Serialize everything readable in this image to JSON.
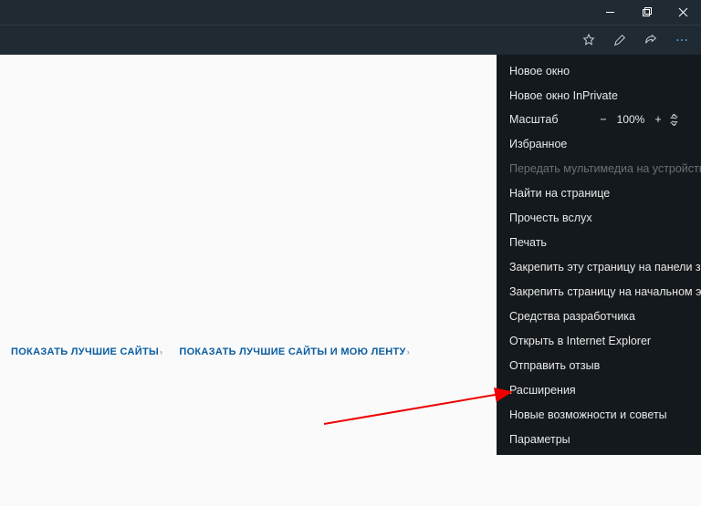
{
  "titlebar": {
    "minimize": "minimize",
    "maximize": "maximize",
    "close": "close"
  },
  "toolbar": {
    "favorite": "add-favorite",
    "notes": "add-notes",
    "share": "share",
    "more": "more"
  },
  "content": {
    "link1": "ПОКАЗАТЬ ЛУЧШИЕ САЙТЫ",
    "link2": "ПОКАЗАТЬ ЛУЧШИЕ САЙТЫ И МОЮ ЛЕНТУ"
  },
  "menu": {
    "items": [
      "Новое окно",
      "Новое окно InPrivate"
    ],
    "zoom_label": "Масштаб",
    "zoom_value": "100%",
    "after_zoom": [
      "Избранное"
    ],
    "disabled": "Передать мультимедиа на устройство",
    "rest": [
      "Найти на странице",
      "Прочесть вслух",
      "Печать",
      "Закрепить эту страницу на панели задач",
      "Закрепить страницу на начальном экране",
      "Средства разработчика",
      "Открыть в Internet Explorer",
      "Отправить отзыв",
      "Расширения",
      "Новые возможности и советы",
      "Параметры"
    ]
  }
}
